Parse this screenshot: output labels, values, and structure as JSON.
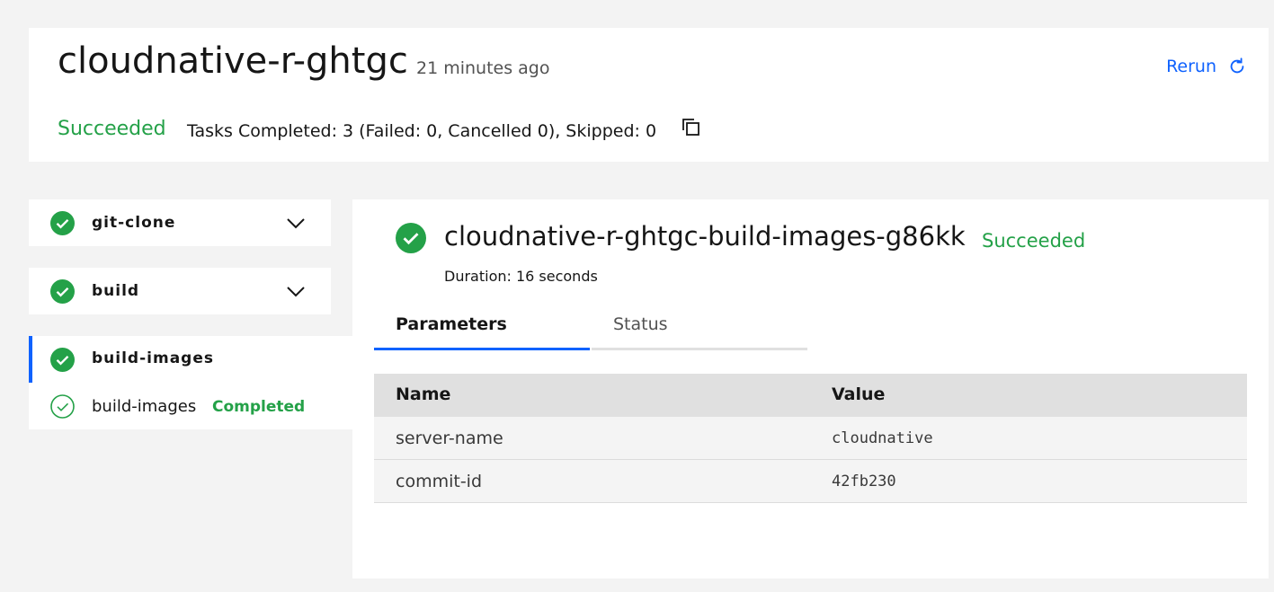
{
  "header": {
    "run_name": "cloudnative-r-ghtgc",
    "age": "21 minutes ago",
    "rerun_label": "Rerun",
    "status": "Succeeded",
    "task_summary": "Tasks Completed: 3 (Failed: 0, Cancelled 0), Skipped: 0"
  },
  "tasks": [
    {
      "label": "git-clone"
    },
    {
      "label": "build"
    },
    {
      "label": "build-images"
    }
  ],
  "active_step": {
    "label": "build-images",
    "status": "Completed"
  },
  "detail": {
    "title": "cloudnative-r-ghtgc-build-images-g86kk",
    "status": "Succeeded",
    "duration": "Duration: 16 seconds",
    "tabs": [
      {
        "label": "Parameters"
      },
      {
        "label": "Status"
      }
    ],
    "table": {
      "headers": {
        "name": "Name",
        "value": "Value"
      },
      "rows": [
        {
          "name": "server-name",
          "value": "cloudnative"
        },
        {
          "name": "commit-id",
          "value": "42fb230"
        }
      ]
    }
  },
  "colors": {
    "success": "#24a148",
    "link": "#0f62fe"
  }
}
